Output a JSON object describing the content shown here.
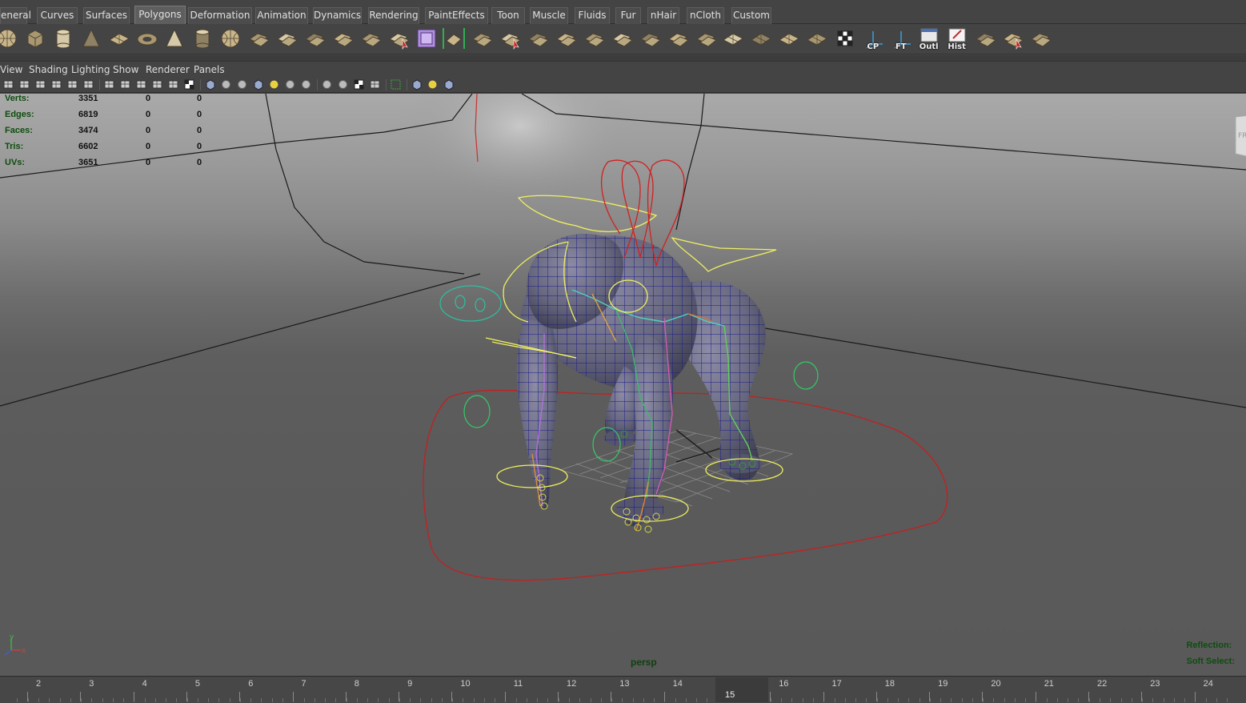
{
  "shelf_tabs": [
    {
      "label": "eneral",
      "active": false
    },
    {
      "label": "Curves",
      "active": false
    },
    {
      "label": "Surfaces",
      "active": false
    },
    {
      "label": "Polygons",
      "active": true
    },
    {
      "label": "Deformation",
      "active": false
    },
    {
      "label": "Animation",
      "active": false
    },
    {
      "label": "Dynamics",
      "active": false
    },
    {
      "label": "Rendering",
      "active": false
    },
    {
      "label": "PaintEffects",
      "active": false
    },
    {
      "label": "Toon",
      "active": false
    },
    {
      "label": "Muscle",
      "active": false
    },
    {
      "label": "Fluids",
      "active": false
    },
    {
      "label": "Fur",
      "active": false
    },
    {
      "label": "nHair",
      "active": false
    },
    {
      "label": "nCloth",
      "active": false
    },
    {
      "label": "Custom",
      "active": false
    }
  ],
  "shelf_icons": [
    {
      "name": "poly-sphere-icon",
      "label": ""
    },
    {
      "name": "poly-cube-icon",
      "label": ""
    },
    {
      "name": "poly-cylinder-icon",
      "label": ""
    },
    {
      "name": "poly-cone-icon",
      "label": ""
    },
    {
      "name": "poly-plane-icon",
      "label": ""
    },
    {
      "name": "poly-torus-icon",
      "label": ""
    },
    {
      "name": "poly-pyramid-icon",
      "label": ""
    },
    {
      "name": "poly-pipe-icon",
      "label": ""
    },
    {
      "name": "poly-soccerball-icon",
      "label": ""
    },
    {
      "name": "combine-icon",
      "label": ""
    },
    {
      "name": "separate-icon",
      "label": ""
    },
    {
      "name": "smooth-icon",
      "label": ""
    },
    {
      "name": "sculpt-icon",
      "label": ""
    },
    {
      "name": "fill-hole-icon",
      "label": ""
    },
    {
      "name": "select-tool-icon",
      "label": ""
    },
    {
      "name": "extrude-icon",
      "label": ""
    },
    {
      "name": "bridge-icon",
      "label": ""
    },
    {
      "name": "append-polygon-icon",
      "label": ""
    },
    {
      "name": "split-polygon-icon",
      "label": ""
    },
    {
      "name": "insert-edge-loop-icon",
      "label": ""
    },
    {
      "name": "offset-edge-icon",
      "label": ""
    },
    {
      "name": "merge-icon",
      "label": ""
    },
    {
      "name": "collapse-icon",
      "label": ""
    },
    {
      "name": "bevel-icon",
      "label": ""
    },
    {
      "name": "wedge-icon",
      "label": ""
    },
    {
      "name": "poke-icon",
      "label": ""
    },
    {
      "name": "planar-map-icon",
      "label": ""
    },
    {
      "name": "cylindrical-map-icon",
      "label": ""
    },
    {
      "name": "spherical-map-icon",
      "label": ""
    },
    {
      "name": "automatic-map-icon",
      "label": ""
    },
    {
      "name": "uv-editor-icon",
      "label": ""
    },
    {
      "name": "center-pivot-icon",
      "label": "CP"
    },
    {
      "name": "freeze-transform-icon",
      "label": "FT"
    },
    {
      "name": "outliner-icon",
      "label": "Outl"
    },
    {
      "name": "history-icon",
      "label": "Hist"
    },
    {
      "name": "mirror-geometry-icon",
      "label": ""
    },
    {
      "name": "reverse-normals-icon",
      "label": ""
    },
    {
      "name": "transfer-attributes-icon",
      "label": ""
    }
  ],
  "panel_menu": [
    "View",
    "Shading",
    "Lighting",
    "Show",
    "Renderer",
    "Panels"
  ],
  "panel_tools": [
    "select-camera-icon",
    "camera-attributes-icon",
    "bookmarks-icon",
    "image-plane-icon",
    "grid-snap-icon",
    "resolution-gate-icon",
    "sep",
    "grid-toggle-icon",
    "film-gate-icon",
    "safe-action-icon",
    "safe-title-icon",
    "field-chart-icon",
    "texture-icon",
    "sep",
    "wireframe-icon",
    "smooth-shade-icon",
    "wireframe-on-shaded-icon",
    "textured-icon",
    "use-lights-icon",
    "shadows-icon",
    "high-quality-icon",
    "sep",
    "ambient-occlusion-icon",
    "motion-blur-icon",
    "anti-alias-icon",
    "depth-of-field-icon",
    "sep",
    "xray-icon",
    "sep",
    "isolate-select-icon",
    "two-sided-lighting-icon",
    "backface-culling-icon"
  ],
  "hud": {
    "stats": [
      {
        "label": "Verts:",
        "v1": "3351",
        "v2": "0",
        "v3": "0"
      },
      {
        "label": "Edges:",
        "v1": "6819",
        "v2": "0",
        "v3": "0"
      },
      {
        "label": "Faces:",
        "v1": "3474",
        "v2": "0",
        "v3": "0"
      },
      {
        "label": "Tris:",
        "v1": "6602",
        "v2": "0",
        "v3": "0"
      },
      {
        "label": "UVs:",
        "v1": "3651",
        "v2": "0",
        "v3": "0"
      }
    ],
    "camera": "persp",
    "reflection_label": "Reflection:",
    "soft_select_label": "Soft Select:",
    "view_cube_label": "FR",
    "axis_labels": {
      "y": "y",
      "x": "x"
    }
  },
  "time_slider": {
    "ticks": [
      "2",
      "3",
      "4",
      "5",
      "6",
      "7",
      "8",
      "9",
      "10",
      "11",
      "12",
      "13",
      "14",
      "15",
      "16",
      "17",
      "18",
      "19",
      "20",
      "21",
      "22",
      "23",
      "24"
    ],
    "current_frame": "15"
  },
  "colors": {
    "hud_label": "#0e4d0e",
    "mesh_wire": "#1a1a8a",
    "rig_yellow": "#f0f060",
    "rig_red": "#d02020",
    "rig_green": "#33cc66"
  }
}
